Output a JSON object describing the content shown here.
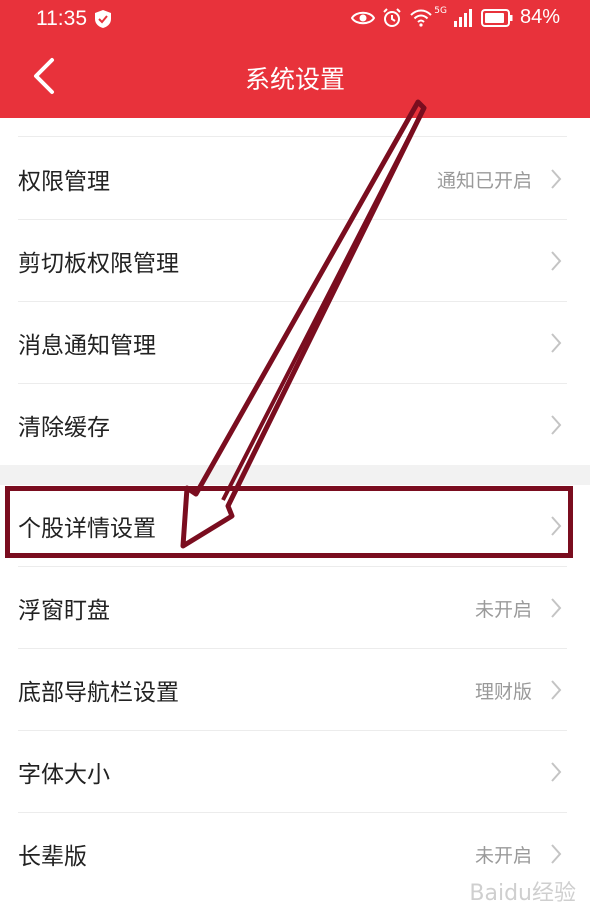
{
  "status_bar": {
    "time": "11:35",
    "network": "5G",
    "battery": "84%"
  },
  "nav": {
    "title": "系统设置"
  },
  "settings_group_1": [
    {
      "label": "权限管理",
      "value": "通知已开启"
    },
    {
      "label": "剪切板权限管理",
      "value": ""
    },
    {
      "label": "消息通知管理",
      "value": ""
    },
    {
      "label": "清除缓存",
      "value": ""
    }
  ],
  "settings_group_2": [
    {
      "label": "个股详情设置",
      "value": ""
    },
    {
      "label": "浮窗盯盘",
      "value": "未开启"
    },
    {
      "label": "底部导航栏设置",
      "value": "理财版"
    },
    {
      "label": "字体大小",
      "value": ""
    },
    {
      "label": "长辈版",
      "value": "未开启"
    }
  ],
  "watermark": "Baidu经验",
  "colors": {
    "header": "#e8323b",
    "annotation": "#7a0d1f"
  }
}
